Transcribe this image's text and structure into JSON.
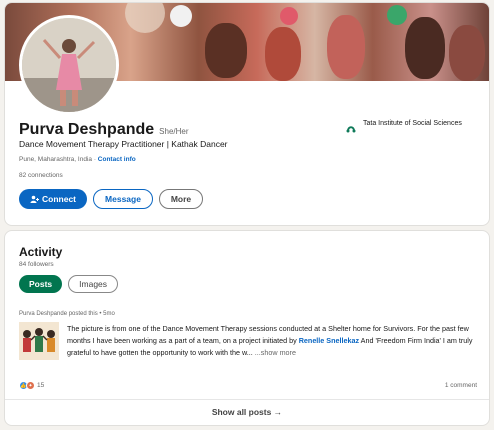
{
  "profile": {
    "name": "Purva Deshpande",
    "pronouns": "She/Her",
    "headline": "Dance Movement Therapy Practitioner | Kathak Dancer",
    "location": "Pune, Maharashtra, India",
    "contact_link": "Contact info",
    "connections": "82 connections",
    "organization": "Tata Institute of Social Sciences",
    "buttons": {
      "connect": "Connect",
      "message": "Message",
      "more": "More"
    }
  },
  "activity": {
    "title": "Activity",
    "followers": "84 followers",
    "tabs": [
      "Posts",
      "Images"
    ],
    "post": {
      "meta": "Purva Deshpande posted this • 5mo",
      "text_before": "The picture is from one of the Dance Movement Therapy sessions conducted at a Shelter home for Survivors. For the past few months I have been working as a part of a team, on a project initiated by",
      "mention": "Renelle Snellekaz",
      "text_after": "And 'Freedom Firm India' I am truly grateful to have gotten the opportunity to work with the w...",
      "more": "...show more",
      "reaction_count": "15",
      "comment_count": "1 comment"
    },
    "show_all": "Show all posts →"
  },
  "colors": {
    "primary": "#0a66c2",
    "active_pill": "#01754f"
  }
}
